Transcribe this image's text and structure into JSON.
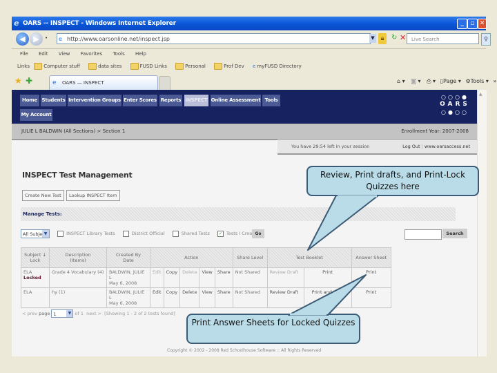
{
  "window": {
    "title": "OARS -- INSPECT - Windows Internet Explorer",
    "controls": [
      "minimize",
      "restore",
      "close"
    ]
  },
  "address_bar": {
    "url": "http://www.oarsonline.net/inspect.jsp",
    "search_placeholder": "Live Search"
  },
  "menu": [
    "File",
    "Edit",
    "View",
    "Favorites",
    "Tools",
    "Help"
  ],
  "links_bar": {
    "label": "Links",
    "items": [
      "Computer stuff",
      "data sites",
      "FUSD Links",
      "Personal",
      "Prof Dev",
      "myFUSD Directory"
    ]
  },
  "tab": {
    "label": "OARS — INSPECT"
  },
  "ie_tools": {
    "page": "Page",
    "tools": "Tools"
  },
  "top_nav": {
    "items": [
      {
        "label": "Home",
        "active": false
      },
      {
        "label": "Students",
        "active": false
      },
      {
        "label": "Intervention Groups",
        "active": false
      },
      {
        "label": "Enter Scores",
        "active": false
      },
      {
        "label": "Reports",
        "active": false
      },
      {
        "label": "INSPECT",
        "active": true
      },
      {
        "label": "Online Assessment",
        "active": false
      },
      {
        "label": "Tools",
        "active": false
      }
    ],
    "second_row": [
      "My Account"
    ],
    "logo": "OARS"
  },
  "breadcrumb": {
    "path": "JULIE L BALDWIN (All Sections) > Section 1",
    "enrollment_year": "Enrollment Year: 2007-2008"
  },
  "session": {
    "message": "You have 29:54 left in your session",
    "logout": "Log Out",
    "separator": "|",
    "site": "www.oarsaccess.net"
  },
  "page": {
    "title": "INSPECT Test Management",
    "buttons": [
      "Create New Test",
      "Lookup INSPECT Item"
    ],
    "manage_label": "Manage Tests:"
  },
  "filters": {
    "subject_select": "All Subjects",
    "checkboxes": [
      {
        "label": "INSPECT Library Tests",
        "checked": false
      },
      {
        "label": "District Official",
        "checked": false
      },
      {
        "label": "Shared Tests",
        "checked": false
      },
      {
        "label": "Tests I Created",
        "checked": true
      }
    ],
    "go": "Go",
    "search_value": "",
    "search_button": "Search"
  },
  "table": {
    "headers": {
      "subject": "Subject",
      "subject_sub": "Lock",
      "description": "Description",
      "description_sub": "(Items)",
      "created": "Created By",
      "created_sub": "Date",
      "action": "Action",
      "share_level": "Share Level",
      "test_booklet": "Test Booklet",
      "answer_sheet": "Answer Sheet"
    },
    "rows": [
      {
        "subject": "ELA",
        "lock": "Locked",
        "description": "Grade 4 Vocabulary (4)",
        "created_by": "BALDWIN, JULIE L",
        "date": "May 6, 2008",
        "actions": [
          "Edit",
          "Copy",
          "Delete",
          "View",
          "Share"
        ],
        "share_level": "Not Shared",
        "review": "Review Draft",
        "booklet": "Print",
        "answer_sheet": "Print"
      },
      {
        "subject": "ELA",
        "lock": "",
        "description": "hy (1)",
        "created_by": "BALDWIN, JULIE L",
        "date": "May 6, 2008",
        "actions": [
          "Edit",
          "Copy",
          "Delete",
          "View",
          "Share"
        ],
        "share_level": "Not Shared",
        "review": "Review Draft",
        "booklet": "Print and Lock",
        "answer_sheet": "Print"
      }
    ]
  },
  "pager": {
    "prev": "< prev",
    "page_label": "page",
    "page_value": "1",
    "of": "of 1",
    "next": "next >",
    "showing": "[Showing 1 - 2 of 2 tests found]"
  },
  "footer": {
    "copyright": "Copyright © 2002 - 2008 Red Schoolhouse Software :: All Rights Reserved"
  },
  "callouts": {
    "top": "Review, Print drafts, and Print-Lock Quizzes here",
    "bottom": "Print Answer Sheets for Locked Quizzes"
  }
}
